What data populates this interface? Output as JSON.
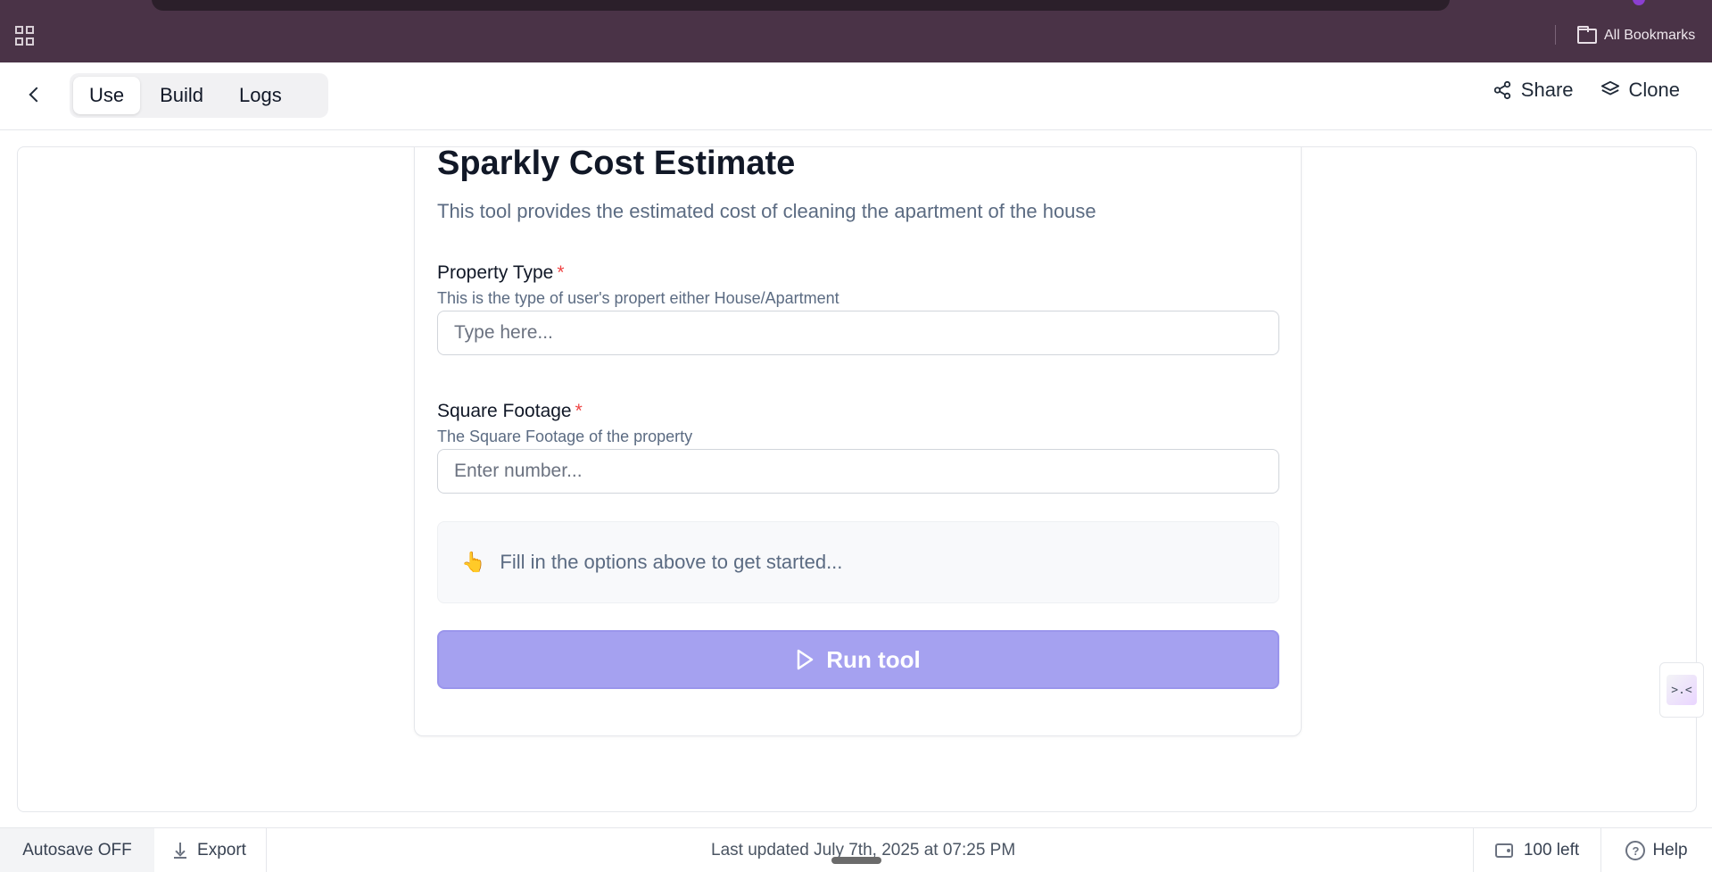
{
  "browser": {
    "bookmarks_label": "All Bookmarks",
    "icons": {
      "apps": "apps-grid-icon",
      "bookmarks": "folder-icon"
    }
  },
  "header": {
    "tabs": [
      {
        "label": "Use",
        "active": true
      },
      {
        "label": "Build",
        "active": false
      },
      {
        "label": "Logs",
        "active": false
      }
    ],
    "share_label": "Share",
    "clone_label": "Clone"
  },
  "tool": {
    "title": "Sparkly Cost Estimate",
    "description": "This tool provides the estimated cost of cleaning the apartment of the house",
    "fields": [
      {
        "label": "Property Type",
        "required_marker": "*",
        "help": "This is the type of user's propert either House/Apartment",
        "placeholder": "Type here...",
        "value": ""
      },
      {
        "label": "Square Footage",
        "required_marker": "*",
        "help": "The Square Footage of the property",
        "placeholder": "Enter number...",
        "value": ""
      }
    ],
    "hint_emoji": "👆",
    "hint_text": "Fill in the options above to get started...",
    "run_label": "Run tool"
  },
  "side_widget_glyph": ">.<",
  "footer": {
    "autosave_label": "Autosave OFF",
    "export_label": "Export",
    "last_updated": "Last updated July 7th, 2025 at 07:25 PM",
    "credits_label": "100 left",
    "help_label": "Help"
  },
  "colors": {
    "browser_bar": "#4a3347",
    "run_button": "#a5a1f0",
    "required": "#ef4444",
    "muted_text": "#5b6b82"
  }
}
